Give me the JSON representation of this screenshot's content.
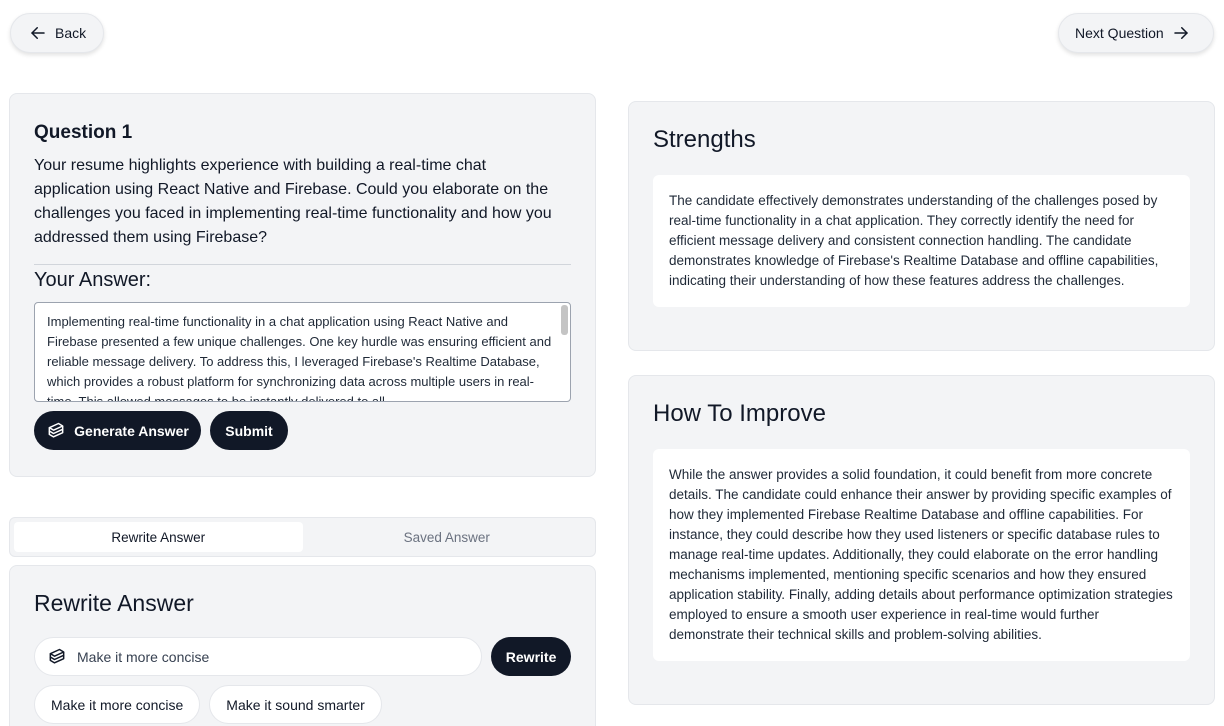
{
  "nav": {
    "back_label": "Back",
    "next_label": "Next Question"
  },
  "question": {
    "title": "Question 1",
    "text": "Your resume highlights experience with building a real-time chat application using React Native and Firebase. Could you elaborate on the challenges you faced in implementing real-time functionality and how you addressed them using Firebase?",
    "answer_label": "Your Answer:",
    "answer_value": "Implementing real-time functionality in a chat application using React Native and Firebase presented a few unique challenges.  One key hurdle was ensuring efficient and reliable message delivery.  To address this, I leveraged Firebase's Realtime Database, which provides a robust platform for synchronizing data across multiple users in real-time.  This allowed messages to be instantly delivered to all",
    "generate_label": "Generate Answer",
    "submit_label": "Submit"
  },
  "tabs": [
    {
      "label": "Rewrite Answer",
      "active": true
    },
    {
      "label": "Saved Answer",
      "active": false
    }
  ],
  "rewrite": {
    "title": "Rewrite Answer",
    "input_value": "Make it more concise",
    "rewrite_label": "Rewrite",
    "chips": [
      "Make it more concise",
      "Make it sound smarter"
    ]
  },
  "strengths": {
    "title": "Strengths",
    "text": "The candidate effectively demonstrates understanding of the challenges posed by real-time functionality in a chat application. They correctly identify the need for efficient message delivery and consistent connection handling. The candidate demonstrates knowledge of Firebase's Realtime Database and offline capabilities, indicating their understanding of how these features address the challenges."
  },
  "improve": {
    "title": "How To Improve",
    "text": "While the answer provides a solid foundation, it could benefit from more concrete details. The candidate could enhance their answer by providing specific examples of how they implemented Firebase Realtime Database and offline capabilities. For instance, they could describe how they used listeners or specific database rules to manage real-time updates. Additionally, they could elaborate on the error handling mechanisms implemented, mentioning specific scenarios and how they ensured application stability. Finally, adding details about performance optimization strategies employed to ensure a smooth user experience in real-time would further demonstrate their technical skills and problem-solving abilities."
  },
  "icons": {
    "back": "arrow-left-icon",
    "next": "arrow-right-icon",
    "ai": "sparkle-icon"
  },
  "colors": {
    "primary_dark": "#111827",
    "card_bg": "#f3f4f6"
  }
}
